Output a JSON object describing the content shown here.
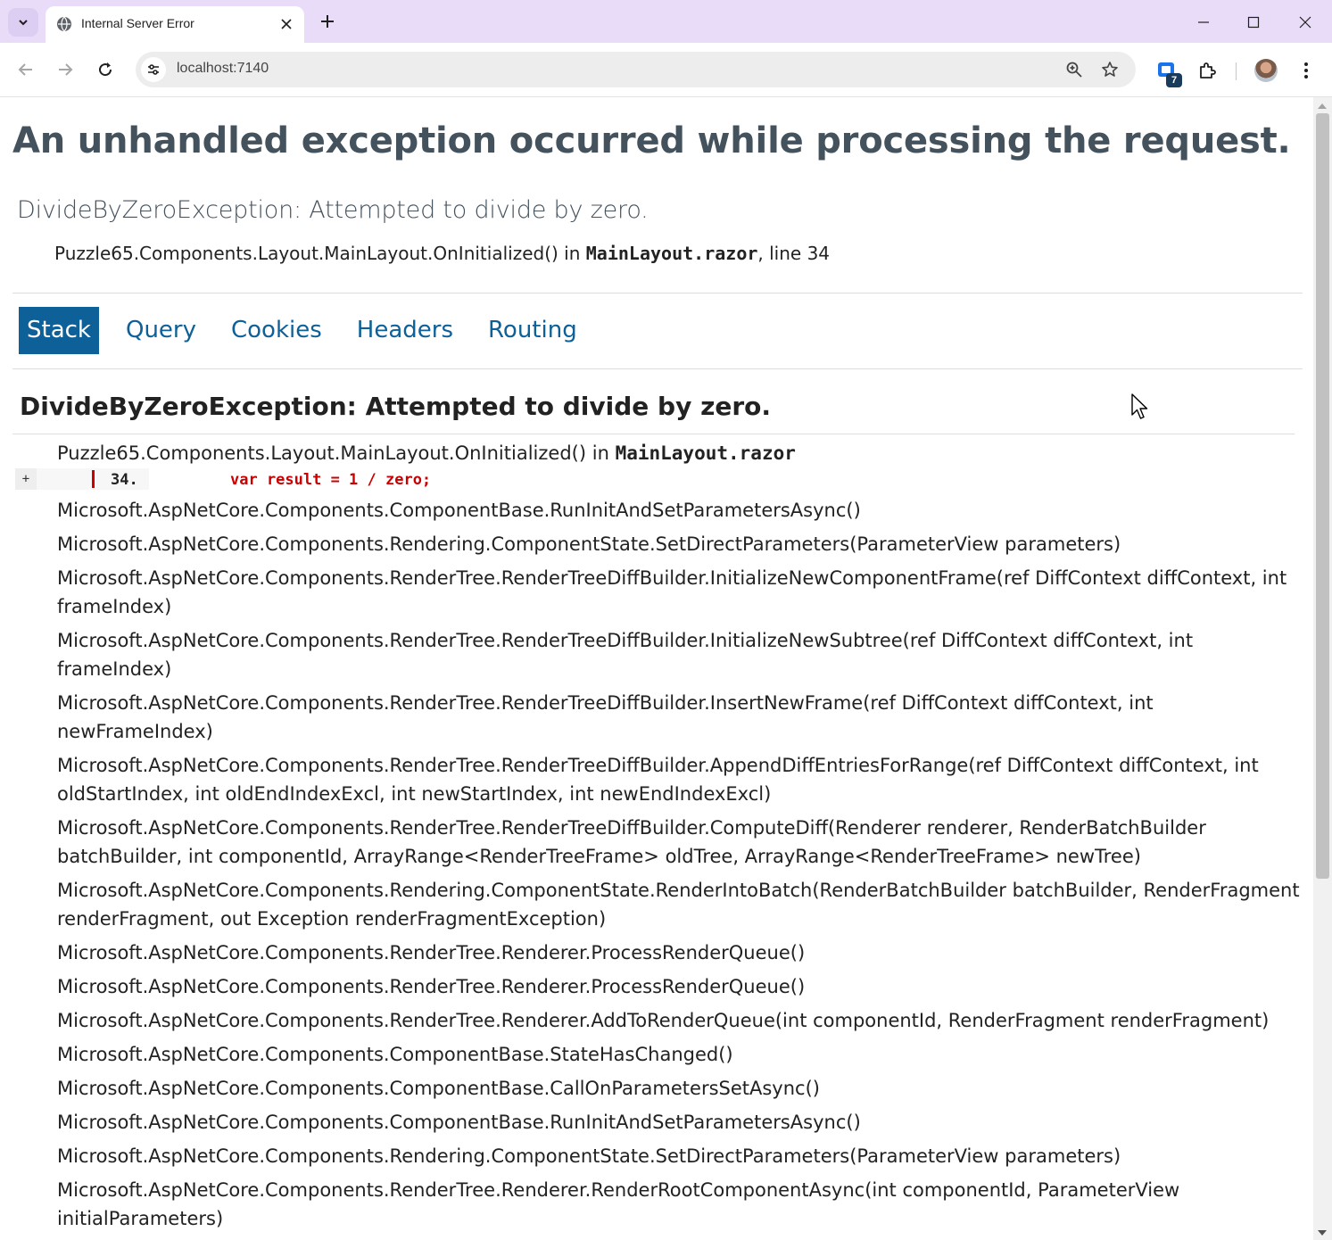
{
  "browser": {
    "tab_title": "Internal Server Error",
    "url": "localhost:7140",
    "extension_badge": "7"
  },
  "page": {
    "heading": "An unhandled exception occurred while processing the request.",
    "exception_summary": "DivideByZeroException: Attempted to divide by zero.",
    "location": {
      "method": "Puzzle65.Components.Layout.MainLayout.OnInitialized()",
      "in": "in",
      "file": "MainLayout.razor",
      "line": ", line 34"
    },
    "tabs": [
      {
        "label": "Stack",
        "active": true
      },
      {
        "label": "Query",
        "active": false
      },
      {
        "label": "Cookies",
        "active": false
      },
      {
        "label": "Headers",
        "active": false
      },
      {
        "label": "Routing",
        "active": false
      }
    ],
    "stack": {
      "title": "DivideByZeroException: Attempted to divide by zero.",
      "first_frame": {
        "method": "Puzzle65.Components.Layout.MainLayout.OnInitialized()",
        "in": "in",
        "file": "MainLayout.razor",
        "expander": "+",
        "line_number": "34.",
        "code": "var result = 1 / zero;"
      },
      "frames": [
        "Microsoft.AspNetCore.Components.ComponentBase.RunInitAndSetParametersAsync()",
        "Microsoft.AspNetCore.Components.Rendering.ComponentState.SetDirectParameters(ParameterView parameters)",
        "Microsoft.AspNetCore.Components.RenderTree.RenderTreeDiffBuilder.InitializeNewComponentFrame(ref DiffContext diffContext, int frameIndex)",
        "Microsoft.AspNetCore.Components.RenderTree.RenderTreeDiffBuilder.InitializeNewSubtree(ref DiffContext diffContext, int frameIndex)",
        "Microsoft.AspNetCore.Components.RenderTree.RenderTreeDiffBuilder.InsertNewFrame(ref DiffContext diffContext, int newFrameIndex)",
        "Microsoft.AspNetCore.Components.RenderTree.RenderTreeDiffBuilder.AppendDiffEntriesForRange(ref DiffContext diffContext, int oldStartIndex, int oldEndIndexExcl, int newStartIndex, int newEndIndexExcl)",
        "Microsoft.AspNetCore.Components.RenderTree.RenderTreeDiffBuilder.ComputeDiff(Renderer renderer, RenderBatchBuilder batchBuilder, int componentId, ArrayRange<RenderTreeFrame> oldTree, ArrayRange<RenderTreeFrame> newTree)",
        "Microsoft.AspNetCore.Components.Rendering.ComponentState.RenderIntoBatch(RenderBatchBuilder batchBuilder, RenderFragment renderFragment, out Exception renderFragmentException)",
        "Microsoft.AspNetCore.Components.RenderTree.Renderer.ProcessRenderQueue()",
        "Microsoft.AspNetCore.Components.RenderTree.Renderer.ProcessRenderQueue()",
        "Microsoft.AspNetCore.Components.RenderTree.Renderer.AddToRenderQueue(int componentId, RenderFragment renderFragment)",
        "Microsoft.AspNetCore.Components.ComponentBase.StateHasChanged()",
        "Microsoft.AspNetCore.Components.ComponentBase.CallOnParametersSetAsync()",
        "Microsoft.AspNetCore.Components.ComponentBase.RunInitAndSetParametersAsync()",
        "Microsoft.AspNetCore.Components.Rendering.ComponentState.SetDirectParameters(ParameterView parameters)",
        "Microsoft.AspNetCore.Components.RenderTree.Renderer.RenderRootComponentAsync(int componentId, ParameterView initialParameters)"
      ]
    }
  },
  "colors": {
    "tabbar": "#e8dcf8",
    "accent": "#0e6198",
    "heading": "#44525e",
    "error_code": "#cc0000"
  }
}
